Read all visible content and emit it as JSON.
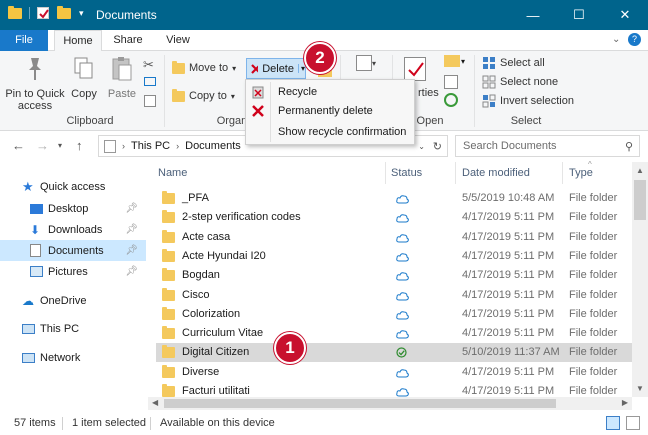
{
  "window": {
    "title": "Documents",
    "minimize": "—",
    "maximize": "☐",
    "close": "✕"
  },
  "tabs": [
    "File",
    "Home",
    "Share",
    "View"
  ],
  "ribbon": {
    "pin_label": "Pin to Quick access",
    "copy_label": "Copy",
    "paste_label": "Paste",
    "clipboard_group": "Clipboard",
    "move_to": "Move to",
    "copy_to": "Copy to",
    "delete": "Delete",
    "organize_group": "Organ",
    "properties_fragment": "rties",
    "open_group": "Open",
    "select_all": "Select all",
    "select_none": "Select none",
    "invert_selection": "Invert selection",
    "select_group": "Select"
  },
  "delete_menu": {
    "items": [
      "Recycle",
      "Permanently delete",
      "Show recycle confirmation"
    ]
  },
  "address": {
    "path": [
      "This PC",
      "Documents"
    ],
    "search_placeholder": "Search Documents"
  },
  "nav": {
    "items": [
      {
        "label": "Quick access",
        "icon": "star-icon"
      },
      {
        "label": "Desktop",
        "icon": "desktop-icon",
        "pinned": true
      },
      {
        "label": "Downloads",
        "icon": "download-icon",
        "pinned": true
      },
      {
        "label": "Documents",
        "icon": "documents-icon",
        "pinned": true,
        "selected": true
      },
      {
        "label": "Pictures",
        "icon": "pictures-icon",
        "pinned": true
      },
      {
        "label": "OneDrive",
        "icon": "cloud-icon"
      },
      {
        "label": "This PC",
        "icon": "computer-icon"
      },
      {
        "label": "Network",
        "icon": "network-icon"
      }
    ]
  },
  "columns": {
    "name": "Name",
    "status": "Status",
    "date": "Date modified",
    "type": "Type"
  },
  "files": [
    {
      "name": "_PFA",
      "status": "cloud",
      "date": "5/5/2019 10:48 AM",
      "type": "File folder"
    },
    {
      "name": "2-step verification codes",
      "status": "cloud",
      "date": "4/17/2019 5:11 PM",
      "type": "File folder"
    },
    {
      "name": "Acte casa",
      "status": "cloud",
      "date": "4/17/2019 5:11 PM",
      "type": "File folder"
    },
    {
      "name": "Acte Hyundai I20",
      "status": "cloud",
      "date": "4/17/2019 5:11 PM",
      "type": "File folder"
    },
    {
      "name": "Bogdan",
      "status": "cloud",
      "date": "4/17/2019 5:11 PM",
      "type": "File folder"
    },
    {
      "name": "Cisco",
      "status": "cloud",
      "date": "4/17/2019 5:11 PM",
      "type": "File folder"
    },
    {
      "name": "Colorization",
      "status": "cloud",
      "date": "4/17/2019 5:11 PM",
      "type": "File folder"
    },
    {
      "name": "Curriculum Vitae",
      "status": "cloud",
      "date": "4/17/2019 5:11 PM",
      "type": "File folder"
    },
    {
      "name": "Digital Citizen",
      "status": "available",
      "date": "5/10/2019 11:37 AM",
      "type": "File folder",
      "selected": true
    },
    {
      "name": "Diverse",
      "status": "cloud",
      "date": "4/17/2019 5:11 PM",
      "type": "File folder"
    },
    {
      "name": "Facturi utilitati",
      "status": "cloud",
      "date": "4/17/2019 5:11 PM",
      "type": "File folder"
    }
  ],
  "status": {
    "items": "57 items",
    "selected": "1 item selected",
    "availability": "Available on this device"
  },
  "badges": [
    "1",
    "2"
  ],
  "colors": {
    "titlebar": "#00648c",
    "file_tab": "#1979ca",
    "badge": "#c8102e",
    "selection": "#d9d9d9",
    "nav_selection": "#cce8ff"
  }
}
